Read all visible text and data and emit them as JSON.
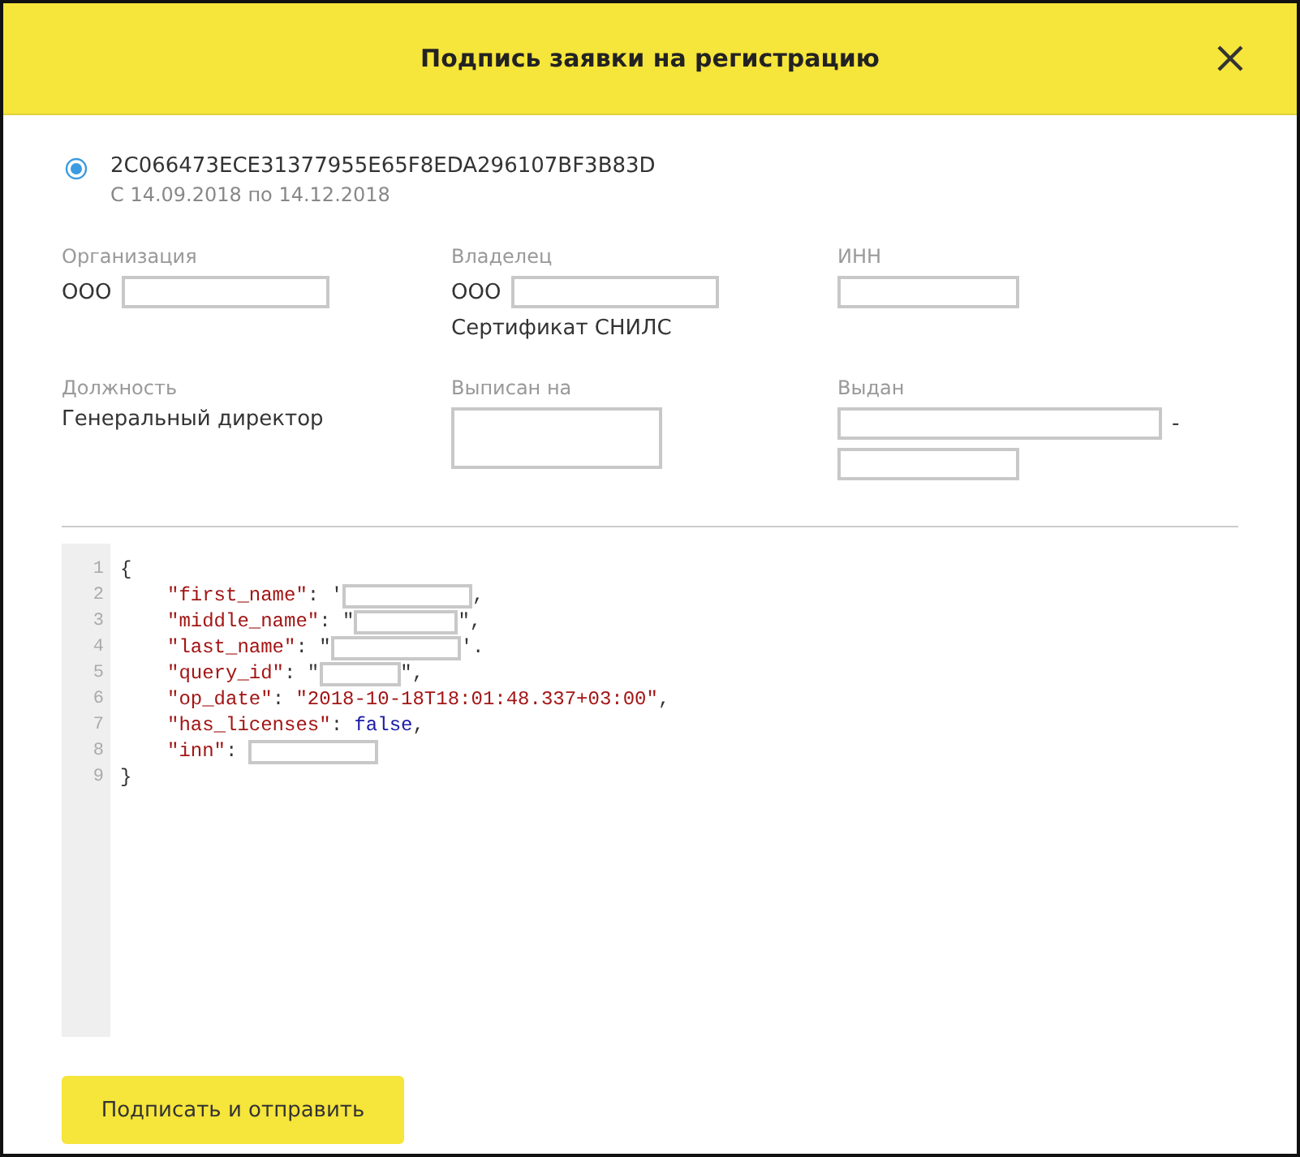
{
  "dialog": {
    "title": "Подпись заявки на регистрацию"
  },
  "certificate": {
    "selected": true,
    "serial": "2C066473ECE31377955E65F8EDA296107BF3B83D",
    "validity": "С 14.09.2018 по 14.12.2018"
  },
  "fields": [
    {
      "label": "Организация",
      "lines": [
        [
          {
            "kind": "text",
            "text": "ООО"
          },
          {
            "kind": "redacted"
          }
        ]
      ]
    },
    {
      "label": "Владелец",
      "lines": [
        [
          {
            "kind": "text",
            "text": "ООО"
          },
          {
            "kind": "redacted"
          }
        ],
        [
          {
            "kind": "text",
            "text": "Сертификат СНИЛС"
          }
        ]
      ]
    },
    {
      "label": "ИНН",
      "lines": [
        [
          {
            "kind": "redacted"
          }
        ]
      ]
    },
    {
      "label": "Должность",
      "lines": [
        [
          {
            "kind": "text",
            "text": "Генеральный директор"
          }
        ]
      ]
    },
    {
      "label": "Выписан на",
      "lines": [
        [
          {
            "kind": "redacted"
          }
        ]
      ]
    },
    {
      "label": "Выдан",
      "lines": [
        [
          {
            "kind": "redacted"
          },
          {
            "kind": "text",
            "text": "-"
          }
        ],
        [
          {
            "kind": "redacted"
          }
        ]
      ]
    }
  ],
  "code_lines": [
    {
      "number": "1",
      "tokens": [
        {
          "kind": "punct",
          "text": "{"
        }
      ]
    },
    {
      "number": "2",
      "tokens": [
        {
          "kind": "key",
          "text": "\"first_name\""
        },
        {
          "kind": "punct",
          "text": ": '"
        },
        {
          "kind": "redacted"
        },
        {
          "kind": "punct",
          "text": ","
        }
      ]
    },
    {
      "number": "3",
      "tokens": [
        {
          "kind": "key",
          "text": "\"middle_name\""
        },
        {
          "kind": "punct",
          "text": ": \""
        },
        {
          "kind": "redacted"
        },
        {
          "kind": "punct",
          "text": "\","
        }
      ]
    },
    {
      "number": "4",
      "tokens": [
        {
          "kind": "key",
          "text": "\"last_name\""
        },
        {
          "kind": "punct",
          "text": ": \""
        },
        {
          "kind": "redacted"
        },
        {
          "kind": "punct",
          "text": "'."
        }
      ]
    },
    {
      "number": "5",
      "tokens": [
        {
          "kind": "key",
          "text": "\"query_id\""
        },
        {
          "kind": "punct",
          "text": ": \""
        },
        {
          "kind": "redacted"
        },
        {
          "kind": "punct",
          "text": "\","
        }
      ]
    },
    {
      "number": "6",
      "tokens": [
        {
          "kind": "key",
          "text": "\"op_date\""
        },
        {
          "kind": "punct",
          "text": ": "
        },
        {
          "kind": "string",
          "text": "\"2018-10-18T18:01:48.337+03:00\""
        },
        {
          "kind": "punct",
          "text": ","
        }
      ]
    },
    {
      "number": "7",
      "tokens": [
        {
          "kind": "key",
          "text": "\"has_licenses\""
        },
        {
          "kind": "punct",
          "text": ": "
        },
        {
          "kind": "literal",
          "text": "false"
        },
        {
          "kind": "punct",
          "text": ","
        }
      ]
    },
    {
      "number": "8",
      "tokens": [
        {
          "kind": "key",
          "text": "\"inn\""
        },
        {
          "kind": "punct",
          "text": ": "
        },
        {
          "kind": "redacted"
        }
      ]
    },
    {
      "number": "9",
      "tokens": [
        {
          "kind": "punct",
          "text": "}"
        }
      ]
    }
  ],
  "submit_button": "Подписать и отправить"
}
